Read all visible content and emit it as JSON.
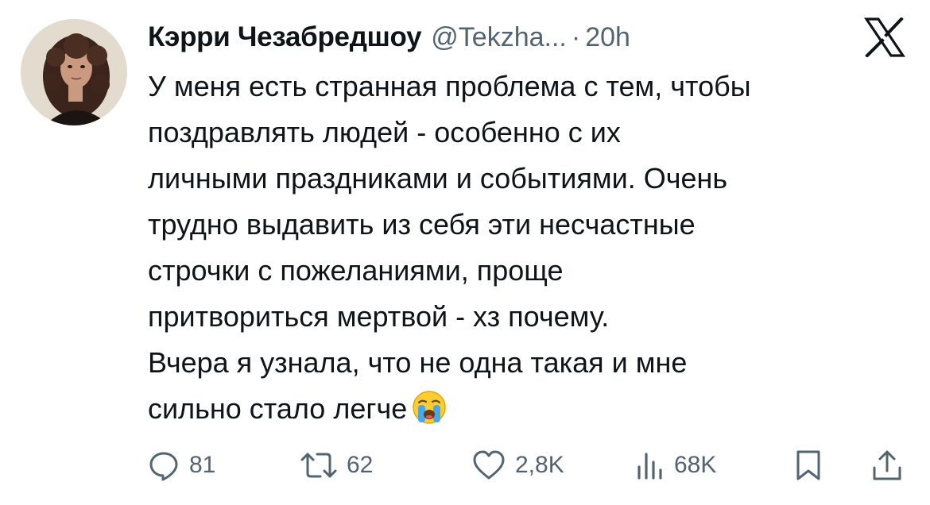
{
  "author": {
    "display_name": "Кэрри Чезабредшоу",
    "handle": "@Tekzha...",
    "separator": "·",
    "time": "20h"
  },
  "tweet": {
    "lines": [
      "У меня есть странная проблема с тем, чтобы",
      "поздравлять людей - особенно с их",
      "личными праздниками и событиями. Очень",
      "трудно выдавить из себя эти несчастные",
      "строчки с пожеланиями, проще",
      "притвориться мертвой - хз почему.",
      "Вчера я узнала, что не одна такая и мне",
      "сильно стало легче"
    ],
    "emoji": "loudly-crying-face"
  },
  "actions": {
    "replies": "81",
    "reposts": "62",
    "likes": "2,8K",
    "views": "68K"
  },
  "icons": {
    "platform": "x-logo",
    "reply": "reply-icon",
    "repost": "repost-icon",
    "like": "heart-icon",
    "views": "views-icon",
    "bookmark": "bookmark-icon",
    "share": "share-icon"
  },
  "colors": {
    "text": "#0f1419",
    "secondary": "#536471"
  }
}
